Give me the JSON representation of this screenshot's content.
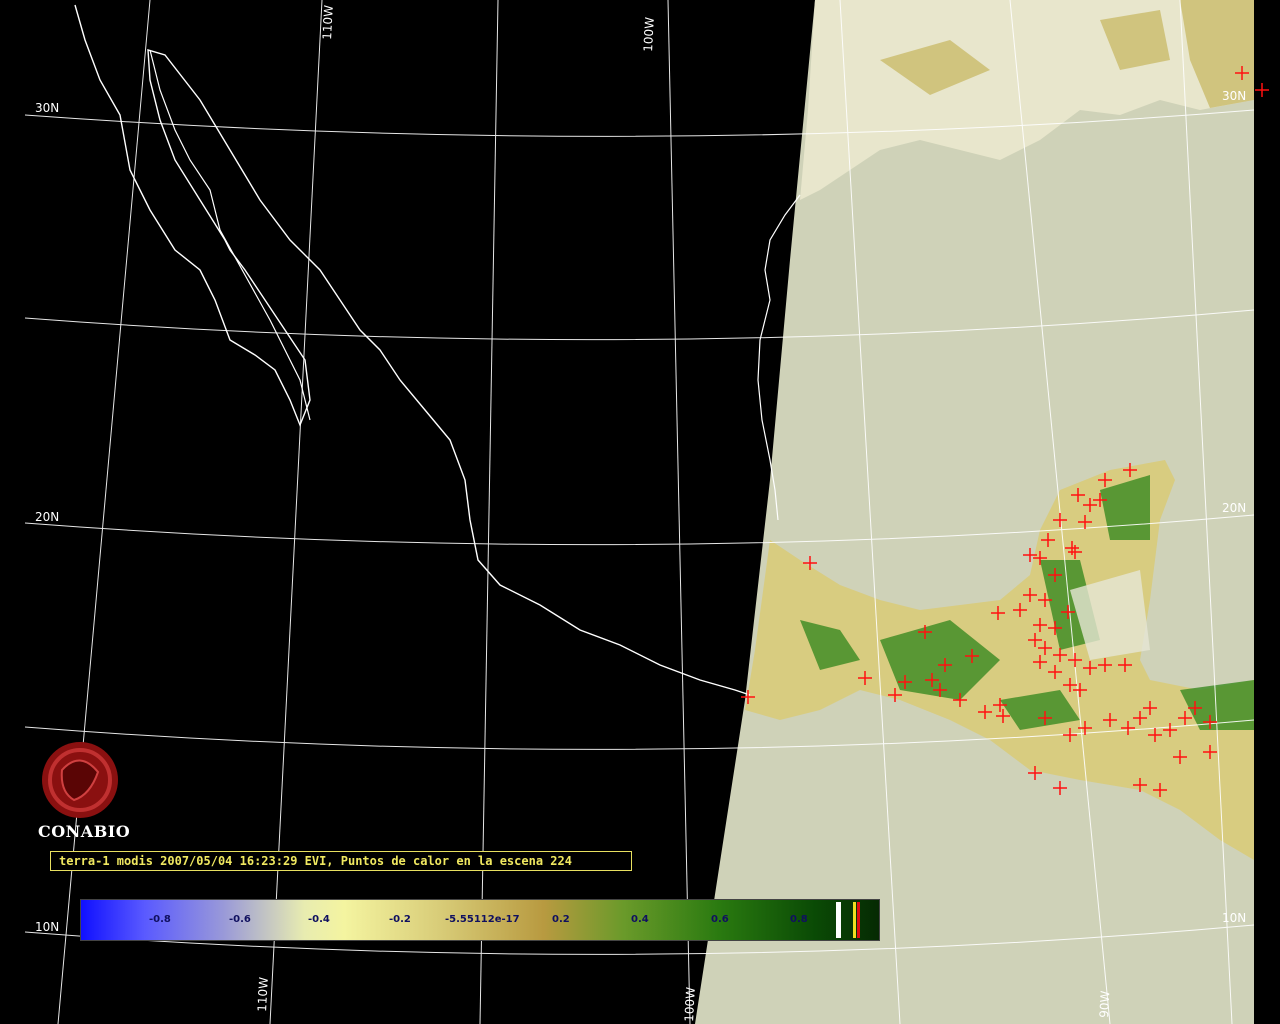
{
  "map": {
    "lon_labels_top": [
      "110W",
      "100W"
    ],
    "lon_labels_bottom": [
      "110W",
      "100W",
      "90W"
    ],
    "lat_labels_left": [
      "30N",
      "20N",
      "10N"
    ],
    "lat_labels_right": [
      "30N",
      "20N",
      "10N"
    ]
  },
  "logo": {
    "text": "CONABIO"
  },
  "caption": "terra-1 modis 2007/05/04 16:23:29 EVI, Puntos de calor en la escena 224",
  "colorbar": {
    "ticks": [
      "-0.8",
      "-0.6",
      "-0.4",
      "-0.2",
      "-5.55112e-17",
      "0.2",
      "0.4",
      "0.6",
      "0.8"
    ]
  },
  "colors": {
    "ocean_swath": "#cfd2b8",
    "grid": "#ffffff",
    "hotspot": "#ff1010",
    "caption_text": "#f0e860"
  }
}
